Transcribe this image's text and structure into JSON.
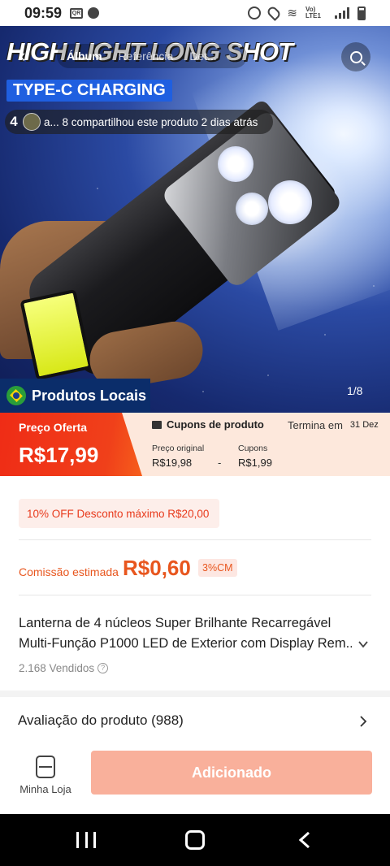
{
  "status_bar": {
    "time": "09:59",
    "lte_label": "Vo) LTE1"
  },
  "hero": {
    "title_overlay": "HIGH LIGHT LONG SHOT",
    "tabs": [
      {
        "label": "Álbum",
        "active": true
      },
      {
        "label": "Referência",
        "active": false
      },
      {
        "label": "Det...",
        "active": false
      }
    ],
    "badge": "TYPE-C CHARGING",
    "share_count": "4",
    "share_text": "a... 8 compartilhou este produto 2 dias atrás",
    "local_tag": "Produtos Locais",
    "image_counter": "1/8"
  },
  "price": {
    "offer_label": "Preço Oferta",
    "offer_price": "R$17,99",
    "coupon_title": "Cupons de produto",
    "ends_label": "Termina em",
    "ends_date": "31 Dez",
    "original_label": "Preço original",
    "original_value": "R$19,98",
    "minus": "-",
    "coupons_label": "Cupons",
    "coupons_value": "R$1,99"
  },
  "discount": {
    "text": "10% OFF Desconto máximo R$20,00"
  },
  "commission": {
    "label": "Comissão estimada",
    "value": "R$0,60",
    "badge": "3%CM"
  },
  "product": {
    "title_line1": "Lanterna de 4 núcleos Super Brilhante Recarregável",
    "title_line2": "Multi-Função P1000 LED de Exterior com Display Rem...",
    "sold": "2.168 Vendidos"
  },
  "review": {
    "label": "Avaliação do produto (988)"
  },
  "bottom_bar": {
    "store_label": "Minha Loja",
    "added_label": "Adicionado"
  },
  "colors": {
    "accent": "#ef2c16",
    "commission": "#e8561e",
    "added_button": "#f9b09b",
    "local_tag_bg": "#0b2d6a",
    "badge_blue": "#1f5fe0"
  },
  "icons": {
    "back": "arrow-left-icon",
    "search": "search-icon",
    "flag": "brazil-flag-icon",
    "coupon": "ticket-icon",
    "expand": "chevron-down-icon",
    "info": "question-circle-icon",
    "review": "chevron-right-icon",
    "store": "store-icon"
  }
}
